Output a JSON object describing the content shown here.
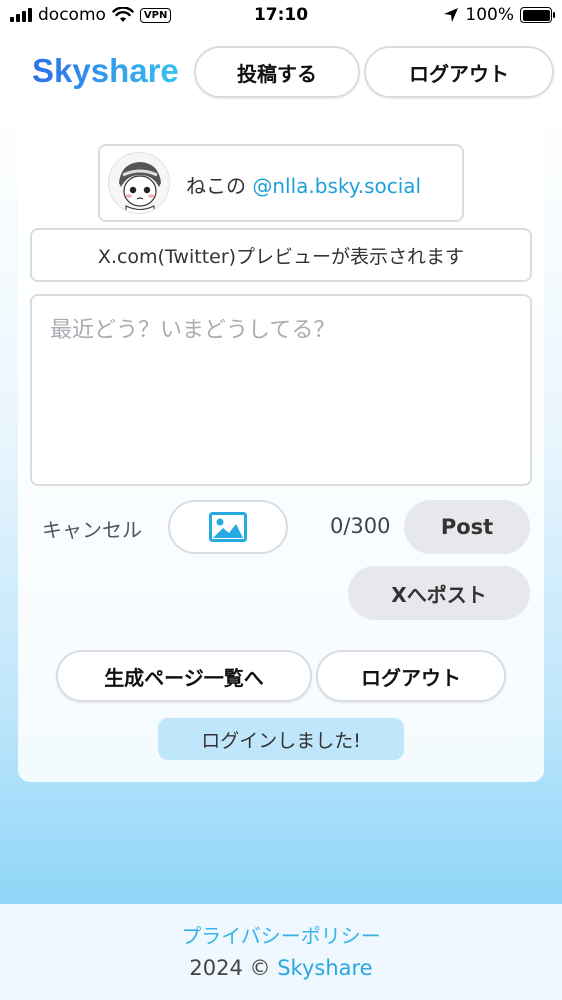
{
  "status_bar": {
    "carrier": "docomo",
    "vpn": "VPN",
    "time": "17:10",
    "battery": "100%"
  },
  "header": {
    "logo": "Skyshare",
    "post_label": "投稿する",
    "logout_label": "ログアウト"
  },
  "user": {
    "display_name": "ねこの",
    "handle": "@nlla.bsky.social"
  },
  "preview": {
    "text": "X.com(Twitter)プレビューが表示されます"
  },
  "composer": {
    "placeholder": "最近どう？いまどうしてる？",
    "cancel_label": "キャンセル",
    "char_count": "0/300",
    "post_label": "Post",
    "xpost_label": "Xへポスト"
  },
  "actions": {
    "list_label": "生成ページ一覧へ",
    "logout_label": "ログアウト"
  },
  "toast": {
    "message": "ログインしました!"
  },
  "footer": {
    "privacy": "プライバシーポリシー",
    "copyright_prefix": "2024 © ",
    "brand": "Skyshare"
  },
  "colors": {
    "accent": "#1ea0d8",
    "gradient_bottom": "#8fd6f8",
    "button_gray": "#e6e8eb"
  }
}
